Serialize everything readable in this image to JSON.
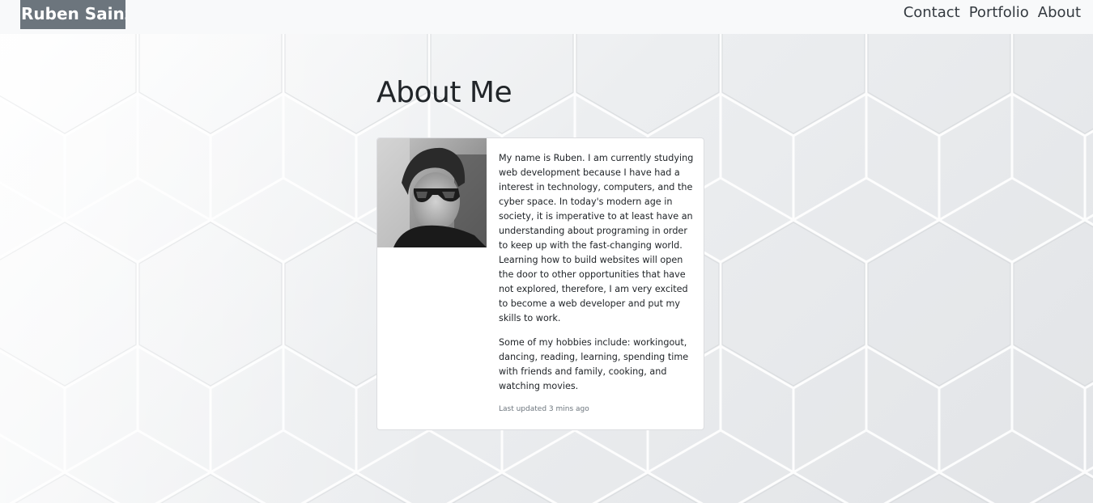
{
  "navbar": {
    "brand": "Ruben Sainz",
    "links": [
      "Contact",
      "Portfolio",
      "About"
    ]
  },
  "page": {
    "title": "About Me"
  },
  "card": {
    "image_icon": "profile-photo",
    "paragraph1": "My name is Ruben. I am currently studying web development because I have had a interest in technology, computers, and the cyber space. In today's modern age in society, it is imperative to at least have an understanding about programing in order to keep up with the fast-changing world. Learning how to build websites will open the door to other opportunities that have not explored, therefore, I am very excited to become a web developer and put my skills to work.",
    "paragraph2": "Some of my hobbies include: workingout, dancing, reading, learning, spending time with friends and family, cooking, and watching movies.",
    "updated": "Last updated 3 mins ago"
  },
  "colors": {
    "brand_bg": "#6c757d",
    "navbar_bg": "#f8f9fa",
    "text": "#212529",
    "muted": "#6c757d"
  }
}
